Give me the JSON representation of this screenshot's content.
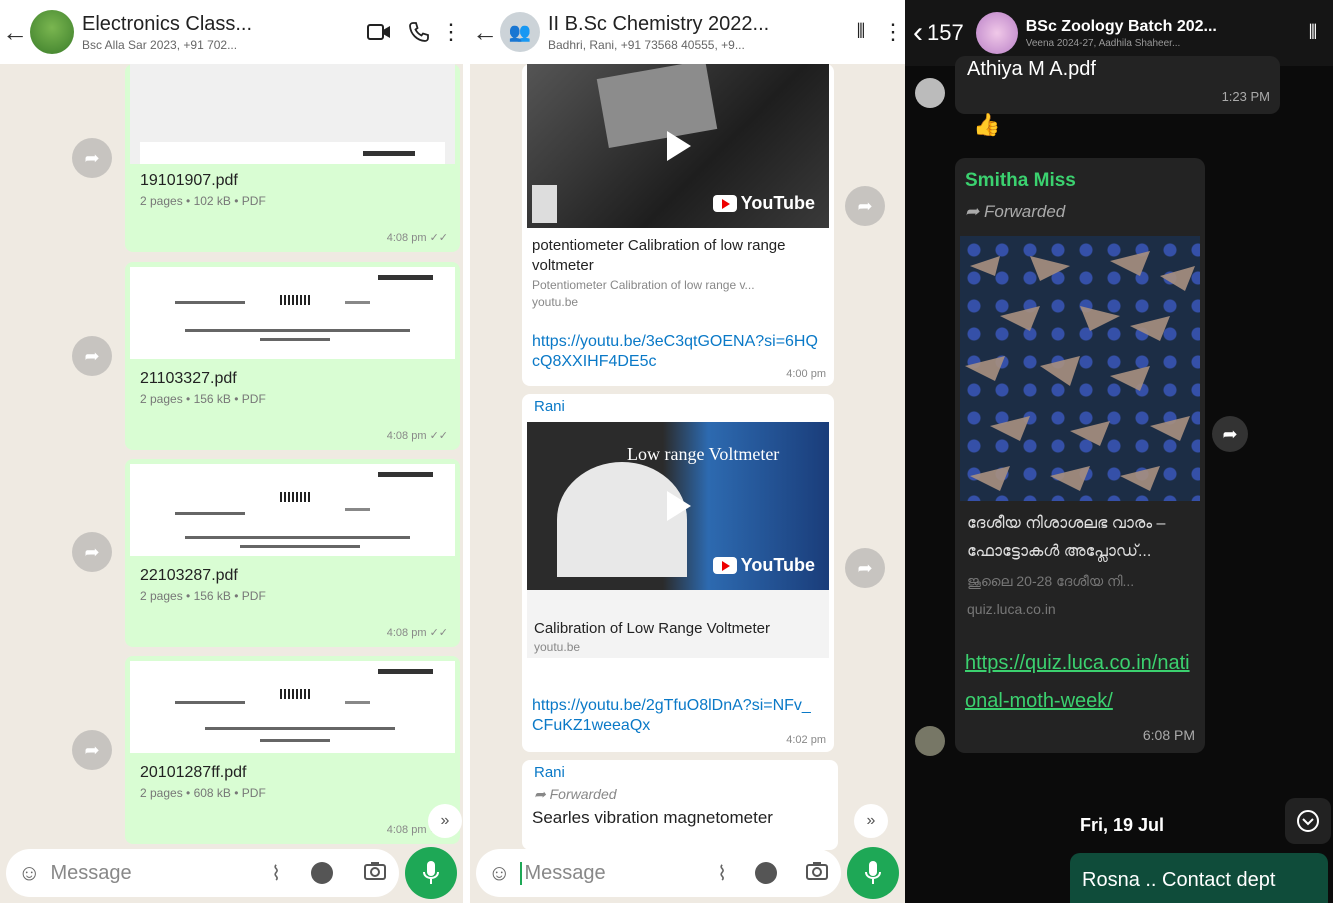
{
  "panel1": {
    "title": "Electronics Class...",
    "subtitle": "Bsc Alla Sar 2023, +91 702...",
    "documents": [
      {
        "name": "19101907.pdf",
        "meta": "2 pages • 102 kB • PDF",
        "time": "4:08 pm"
      },
      {
        "name": "21103327.pdf",
        "meta": "2 pages • 156 kB • PDF",
        "time": "4:08 pm"
      },
      {
        "name": "22103287.pdf",
        "meta": "2 pages • 156 kB • PDF",
        "time": "4:08 pm"
      },
      {
        "name": "20101287ff.pdf",
        "meta": "2 pages • 608 kB • PDF",
        "time": "4:08 pm"
      }
    ],
    "message_placeholder": "Message"
  },
  "panel2": {
    "title": "II B.Sc Chemistry  2022...",
    "subtitle": "Badhri, Rani, +91 73568 40555, +9...",
    "video1": {
      "title": "potentiometer Calibration of low range voltmeter",
      "desc": "Potentiometer Calibration of low range v...",
      "domain": "youtu.be",
      "link": "https://youtu.be/3eC3qtGOENA?si=6HQcQ8XXIHF4DE5c",
      "time": "4:00 pm"
    },
    "video2": {
      "sender": "Rani",
      "overlay_text": "Low range Voltmeter",
      "title": "Calibration of Low Range Voltmeter",
      "domain": "youtu.be",
      "link": "https://youtu.be/2gTfuO8lDnA?si=NFv_CFuKZ1weeaQx",
      "time": "4:02 pm"
    },
    "forwarded_msg": {
      "sender": "Rani",
      "forwarded_label": "Forwarded",
      "text": "Searles vibration magnetometer"
    },
    "youtube_label": "YouTube",
    "message_placeholder": "Message"
  },
  "panel3": {
    "back_count": "157",
    "title": "BSc Zoology Batch 202...",
    "subtitle": "Veena 2024-27, Aadhila Shaheer...",
    "file_msg": {
      "name": "Athiya M A.pdf",
      "time": "1:23 PM"
    },
    "reaction": "👍",
    "forwarded_msg": {
      "sender": "Smitha Miss",
      "forwarded_label": "Forwarded",
      "preview_title": "ദേശീയ നിശാശലഭ വാരം – ഫോട്ടോകൾ അപ്ലോഡ്...",
      "preview_desc": "ജൂലൈ 20-28 ദേശീയ നി...",
      "preview_domain": "quiz.luca.co.in",
      "link": "https://quiz.luca.co.in/national-moth-week/",
      "time": "6:08 PM"
    },
    "date_chip": "Fri, 19 Jul",
    "last_msg": "Rosna .. Contact dept"
  },
  "colors": {
    "sender_green": "#3bd16f",
    "link_blue": "#0a79c7",
    "mic_green": "#1ea856",
    "outgoing_bubble": "#d9fdd3",
    "chat_bg": "#efeae2"
  }
}
